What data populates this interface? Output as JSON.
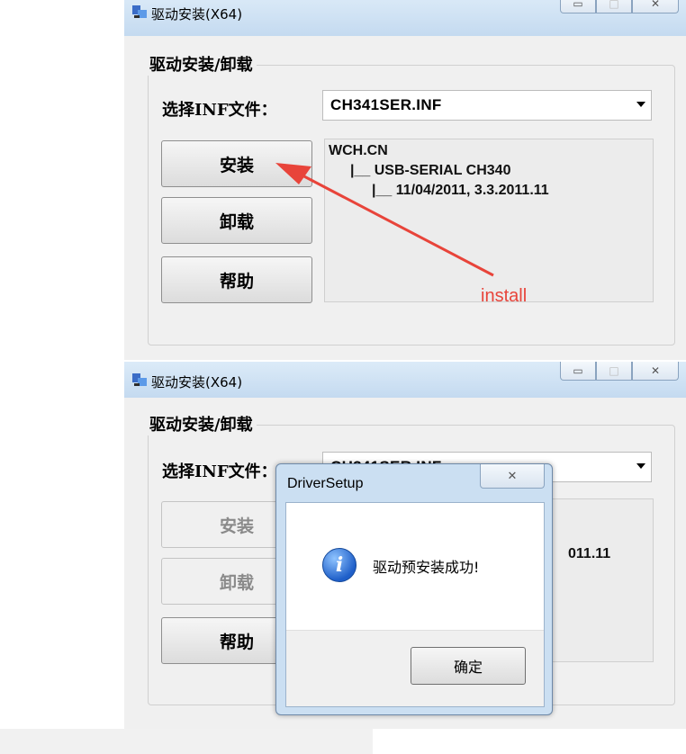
{
  "window1": {
    "title": "驱动安装(X64)",
    "group_title": "驱动安装/卸载",
    "inf_label": "选择INF文件：",
    "inf_selected": "CH341SER.INF",
    "buttons": {
      "install": "安装",
      "uninstall": "卸载",
      "help": "帮助"
    },
    "info_lines": [
      "WCH.CN",
      "|__ USB-SERIAL CH340",
      "|__ 11/04/2011, 3.3.2011.11"
    ],
    "annotation": "install"
  },
  "window2": {
    "title": "驱动安装(X64)",
    "group_title": "驱动安装/卸载",
    "inf_label": "选择INF文件：",
    "inf_selected": "CH341SER.INF",
    "buttons": {
      "install": "安装",
      "uninstall": "卸载",
      "help": "帮助"
    },
    "info_line_visible": "011.11"
  },
  "dialog": {
    "title": "DriverSetup",
    "message": "驱动预安装成功!",
    "ok": "确定",
    "close_glyph": "✕"
  },
  "titlebar_buttons": {
    "minimize": "▭",
    "maximize": "□",
    "close": "✕"
  },
  "colors": {
    "annotation": "#e8443a",
    "titlebar": "#c4daf0"
  }
}
